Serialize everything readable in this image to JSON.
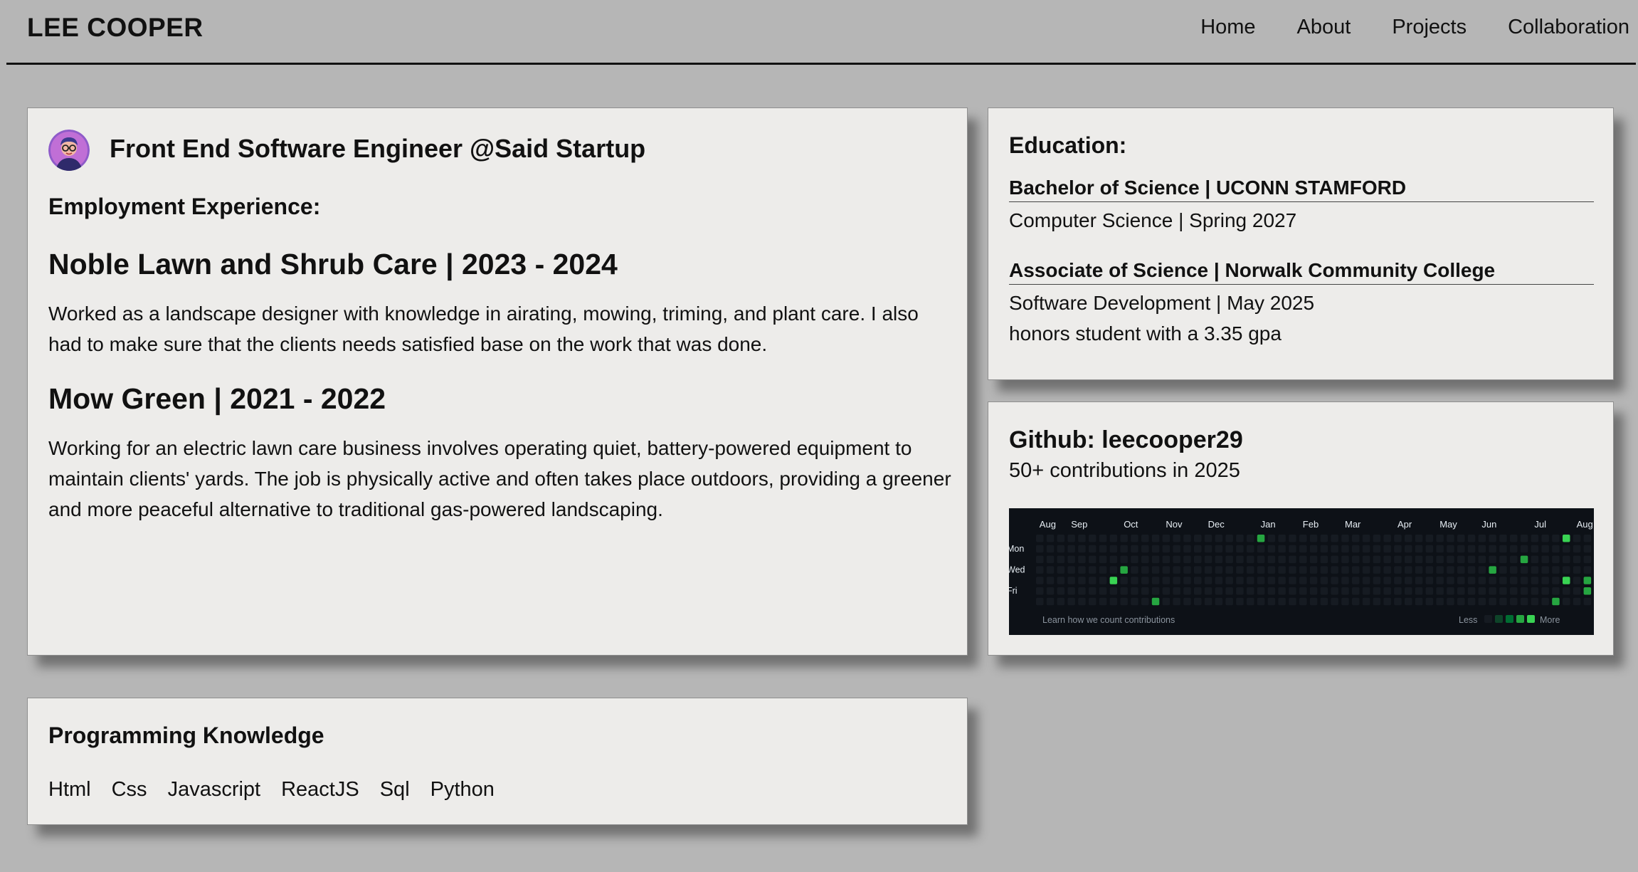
{
  "header": {
    "brand": "LEE COOPER",
    "nav": [
      "Home",
      "About",
      "Projects",
      "Collaboration"
    ]
  },
  "experience": {
    "role": "Front End Software Engineer @Said Startup",
    "heading": "Employment Experience:",
    "jobs": [
      {
        "title": "Noble Lawn and Shrub Care | 2023 - 2024",
        "description": "Worked as a landscape designer with knowledge in airating, mowing, triming, and plant care. I also had to make sure that the clients needs satisfied base on the work that was done."
      },
      {
        "title": "Mow Green | 2021 - 2022",
        "description": "Working for an electric lawn care business involves operating quiet, battery-powered equipment to maintain clients' yards. The job is physically active and often takes place outdoors, providing a greener and more peaceful alternative to traditional gas-powered landscaping."
      }
    ]
  },
  "education": {
    "title": "Education:",
    "degrees": [
      {
        "degree": "Bachelor of Science | UCONN STAMFORD",
        "lines": [
          "Computer Science | Spring 2027"
        ]
      },
      {
        "degree": "Associate of Science | Norwalk Community College",
        "lines": [
          "Software Development | May 2025",
          "honors student with a 3.35 gpa"
        ]
      }
    ]
  },
  "github": {
    "title": "Github: leecooper29",
    "subtitle": "50+ contributions in 2025",
    "graph": {
      "months": [
        "Aug",
        "Sep",
        "Oct",
        "Nov",
        "Dec",
        "Jan",
        "Feb",
        "Mar",
        "Apr",
        "May",
        "Jun",
        "Jul",
        "Aug"
      ],
      "days": [
        "Mon",
        "Wed",
        "Fri"
      ],
      "footer": "Learn how we count contributions",
      "legend_less": "Less",
      "legend_more": "More",
      "empty_color": "#161b22",
      "level_colors": [
        "#161b22",
        "#0e4429",
        "#006d32",
        "#26a641",
        "#39d353"
      ],
      "active": [
        {
          "week": 7,
          "day": 4,
          "level": 4
        },
        {
          "week": 8,
          "day": 3,
          "level": 3
        },
        {
          "week": 11,
          "day": 6,
          "level": 3
        },
        {
          "week": 21,
          "day": 0,
          "level": 3
        },
        {
          "week": 43,
          "day": 3,
          "level": 3
        },
        {
          "week": 46,
          "day": 2,
          "level": 3
        },
        {
          "week": 49,
          "day": 6,
          "level": 3
        },
        {
          "week": 50,
          "day": 0,
          "level": 4
        },
        {
          "week": 50,
          "day": 4,
          "level": 4
        },
        {
          "week": 52,
          "day": 4,
          "level": 3
        },
        {
          "week": 52,
          "day": 5,
          "level": 3
        }
      ]
    }
  },
  "programming": {
    "title": "Programming Knowledge",
    "skills": [
      "Html",
      "Css",
      "Javascript",
      "ReactJS",
      "Sql",
      "Python"
    ]
  }
}
